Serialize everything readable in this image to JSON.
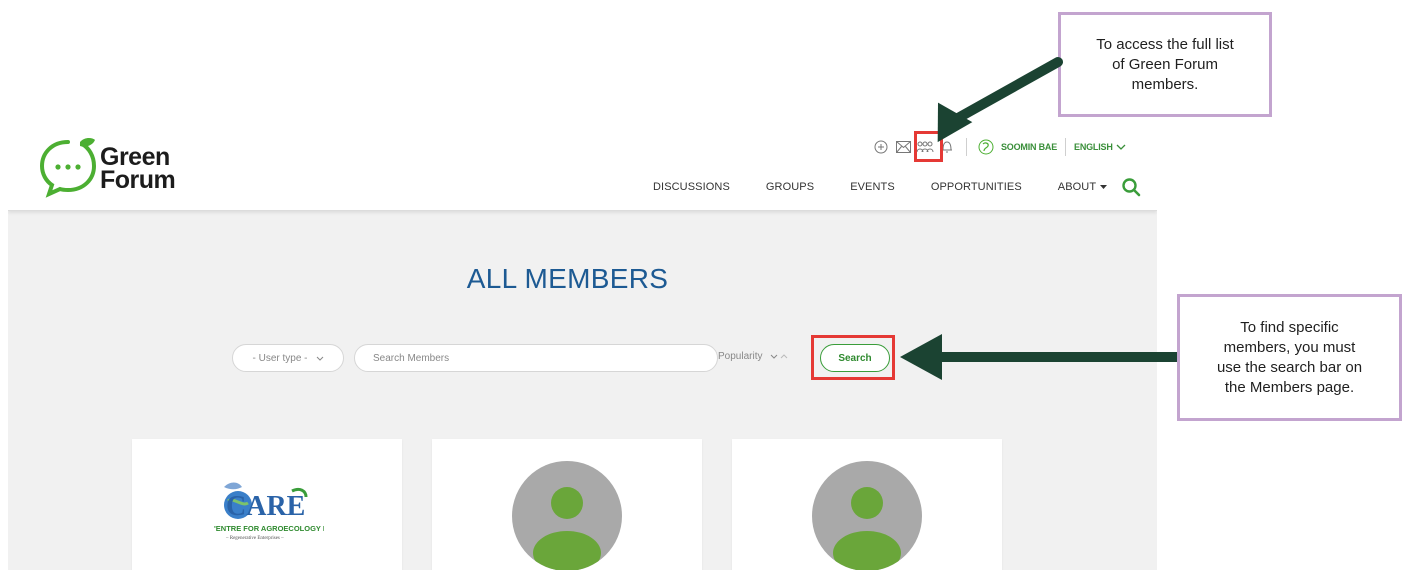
{
  "brand": {
    "name_line1": "Green",
    "name_line2": "Forum"
  },
  "topbar": {
    "user_name": "SOOMIN BAE",
    "language": "ENGLISH"
  },
  "nav": {
    "items": [
      "DISCUSSIONS",
      "GROUPS",
      "EVENTS",
      "OPPORTUNITIES"
    ],
    "about_label": "ABOUT"
  },
  "page": {
    "title": "ALL MEMBERS"
  },
  "filters": {
    "user_type_label": "- User type -",
    "search_placeholder": "Search Members",
    "sort_label": "Popularity",
    "search_button": "Search"
  },
  "cards": {
    "org_logo_text": "CARE",
    "org_logo_subtitle": "'ENTRE FOR AGROECOLOGY F",
    "org_logo_tagline": "– Regenerative Enterprises –"
  },
  "annotations": {
    "callout_members": "To access the full list\nof Green Forum\nmembers.",
    "callout_search": "To find specific\nmembers, you must\nuse the search bar on\nthe Members page."
  },
  "colors": {
    "brand_green": "#3a9d3a",
    "title_blue": "#1d5a93",
    "highlight_red": "#e53935",
    "arrow_green": "#1b4332",
    "callout_border": "#c3a4cf"
  }
}
